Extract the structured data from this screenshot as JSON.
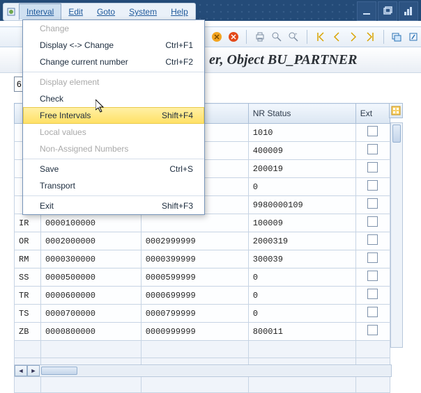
{
  "menubar": {
    "items": [
      {
        "label": "Interval",
        "open": true
      },
      {
        "label": "Edit"
      },
      {
        "label": "Goto"
      },
      {
        "label": "System"
      },
      {
        "label": "Help"
      }
    ]
  },
  "dropdown": {
    "items": [
      {
        "label": "Change",
        "disabled": true
      },
      {
        "label": "Display <-> Change",
        "shortcut": "Ctrl+F1"
      },
      {
        "label": "Change current number",
        "shortcut": "Ctrl+F2"
      },
      {
        "label": "Display element",
        "disabled": true
      },
      {
        "label": "Check"
      },
      {
        "label": "Free Intervals",
        "shortcut": "Shift+F4",
        "highlight": true
      },
      {
        "label": "Local values",
        "disabled": true
      },
      {
        "label": "Non-Assigned Numbers",
        "disabled": true
      },
      {
        "label": "Save",
        "shortcut": "Ctrl+S"
      },
      {
        "label": "Transport"
      },
      {
        "label": "Exit",
        "shortcut": "Shift+F3"
      }
    ]
  },
  "header": {
    "title_visible": "er, Object BU_PARTNER"
  },
  "input_value": "6",
  "table": {
    "columns": {
      "nr_status": "NR Status",
      "ext": "Ext"
    },
    "rows": [
      {
        "code": "",
        "from": "",
        "to": "",
        "status": "1010",
        "ext": false
      },
      {
        "code": "",
        "from": "",
        "to": "",
        "status": "400009",
        "ext": false
      },
      {
        "code": "",
        "from": "",
        "to": "",
        "status": "200019",
        "ext": false
      },
      {
        "code": "",
        "from": "",
        "to": "",
        "status": "0",
        "ext": false
      },
      {
        "code": "",
        "from": "",
        "to": "",
        "status": "9980000109",
        "ext": false
      },
      {
        "code": "IR",
        "from": "0000100000",
        "to": "",
        "status": "100009",
        "ext": false
      },
      {
        "code": "OR",
        "from": "0002000000",
        "to": "0002999999",
        "status": "2000319",
        "ext": false
      },
      {
        "code": "RM",
        "from": "0000300000",
        "to": "0000399999",
        "status": "300039",
        "ext": false
      },
      {
        "code": "SS",
        "from": "0000500000",
        "to": "0000599999",
        "status": "0",
        "ext": false
      },
      {
        "code": "TR",
        "from": "0000600000",
        "to": "0000699999",
        "status": "0",
        "ext": false
      },
      {
        "code": "TS",
        "from": "0000700000",
        "to": "0000799999",
        "status": "0",
        "ext": false
      },
      {
        "code": "ZB",
        "from": "0000800000",
        "to": "0000999999",
        "status": "800011",
        "ext": false
      }
    ]
  }
}
